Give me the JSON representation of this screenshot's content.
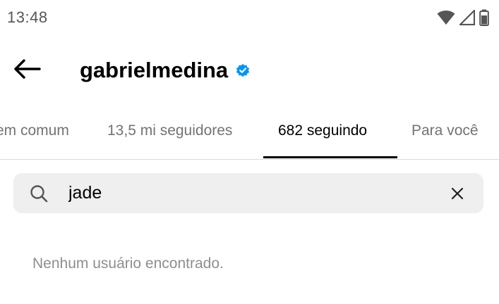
{
  "status_bar": {
    "time": "13:48",
    "icons": [
      "wifi-icon",
      "signal-icon",
      "battery-icon"
    ]
  },
  "header": {
    "back_icon": "arrow-left-icon",
    "username": "gabrielmedina",
    "verified_icon": "verified-badge-icon",
    "verified_color": "#0095f6"
  },
  "tabs": [
    {
      "label": "em comum",
      "active": false
    },
    {
      "label": "13,5 mi seguidores",
      "active": false
    },
    {
      "label": "682 seguindo",
      "active": true
    },
    {
      "label": "Para você",
      "active": false
    }
  ],
  "search": {
    "icon": "search-icon",
    "value": "jade",
    "clear_icon": "close-icon"
  },
  "empty_state": {
    "message": "Nenhum usuário encontrado."
  }
}
